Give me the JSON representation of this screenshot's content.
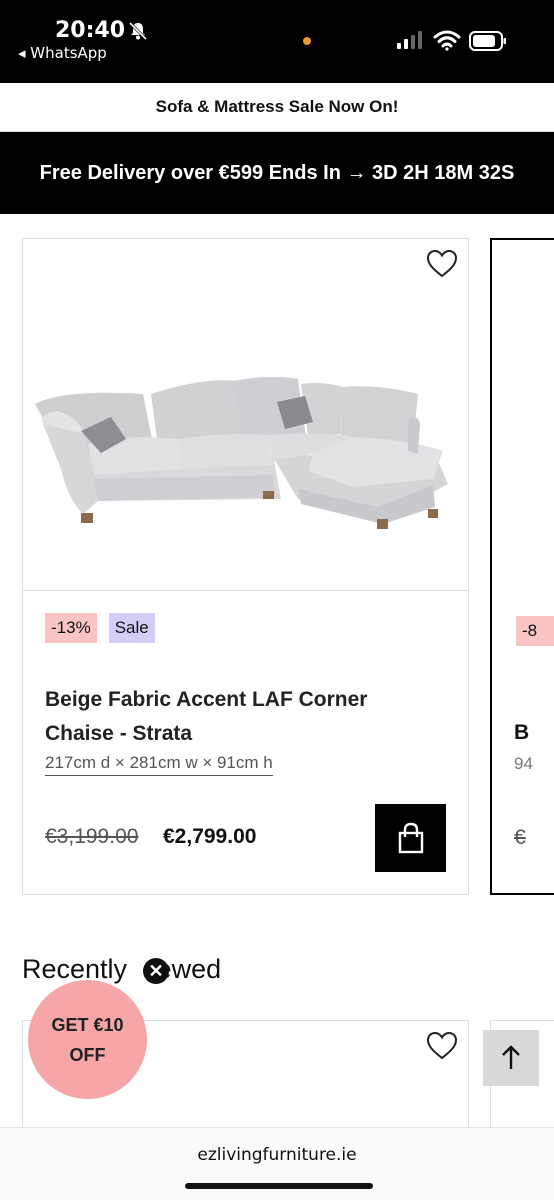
{
  "status_bar": {
    "time": "20:40",
    "back_app": "◂ WhatsApp"
  },
  "banners": {
    "sale": "Sofa & Mattress Sale Now On!",
    "delivery": "Free Delivery over €599 Ends In → 3D 2H 18M 32S"
  },
  "product": {
    "badges": {
      "discount": "-13%",
      "sale": "Sale"
    },
    "title": "Beige Fabric Accent LAF Corner Chaise - Strata",
    "dimensions": "217cm d × 281cm w × 91cm h",
    "price_old": "€3,199.00",
    "price_new": "€2,799.00",
    "icons": {
      "favourite": "heart-icon",
      "cart": "shopping-bag-icon"
    }
  },
  "peek_card": {
    "badge": "-8",
    "title": "B",
    "dims": "94",
    "price": "€"
  },
  "recently_viewed": {
    "heading_part1": "Recently ",
    "heading_part2": "iewed",
    "close_glyph": "✕"
  },
  "offer": {
    "line1": "GET €10",
    "line2": "OFF"
  },
  "browser": {
    "url": "ezlivingfurniture.ie"
  },
  "colors": {
    "banner_black": "#000000",
    "discount_badge": "#f9c4c4",
    "sale_badge": "#d6cdf6",
    "offer_bubble": "#f6a6a6"
  }
}
